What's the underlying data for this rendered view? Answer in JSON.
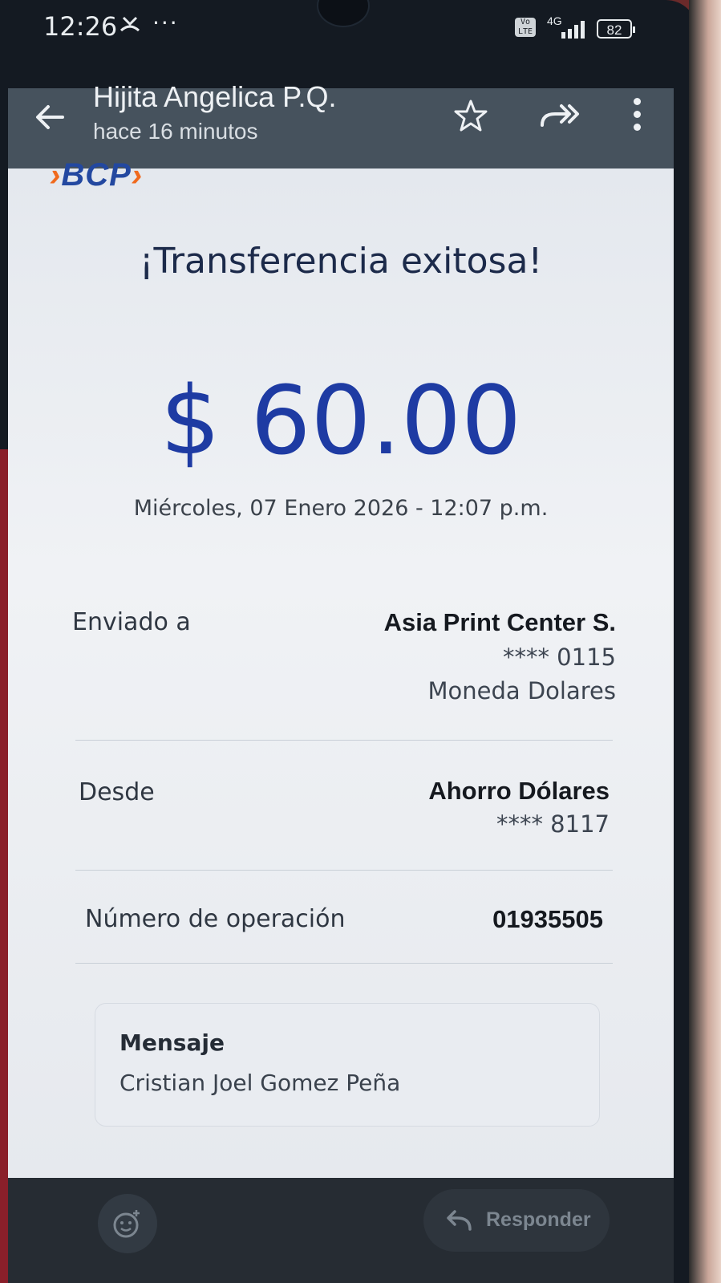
{
  "status_bar": {
    "time": "12:26",
    "dots": "···",
    "network_badge": "Vo LTE",
    "network_type": "4G",
    "battery": "82"
  },
  "mail_header": {
    "sender": "Hijita Angelica P.Q.",
    "time_ago": "hace 16 minutos"
  },
  "receipt": {
    "bank_logo": "BCP",
    "title": "¡Transferencia exitosa!",
    "amount": "$ 60.00",
    "date": "Miércoles, 07 Enero 2026 - 12:07 p.m.",
    "sent_to": {
      "label": "Enviado a",
      "name": "Asia Print Center S.",
      "account": "**** 0115",
      "currency": "Moneda Dolares"
    },
    "from": {
      "label": "Desde",
      "account_name": "Ahorro Dólares",
      "account": "**** 8117"
    },
    "operation": {
      "label": "Número de operación",
      "number": "01935505"
    },
    "message": {
      "label": "Mensaje",
      "text": "Cristian Joel Gomez Peña"
    }
  },
  "bottom_bar": {
    "reply_label": "Responder"
  },
  "colors": {
    "amount": "#1e3ba3",
    "header_bg": "#46525d",
    "bcp_blue": "#2348a0",
    "bcp_orange": "#f06a1e"
  }
}
